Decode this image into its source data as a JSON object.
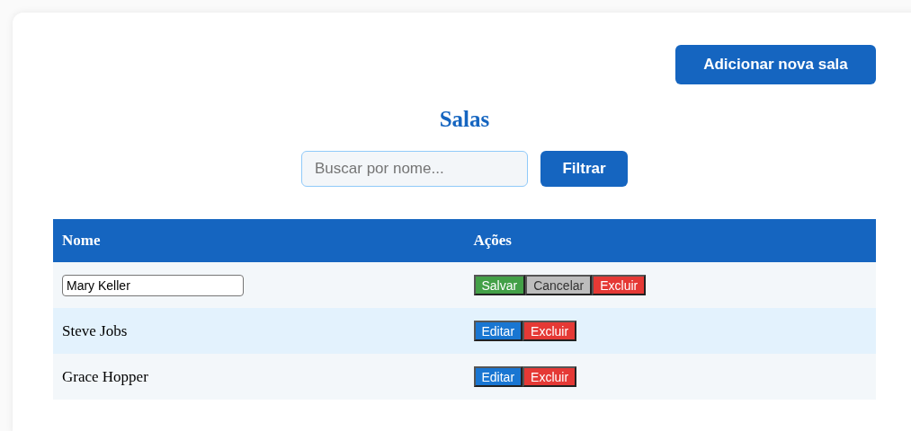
{
  "add_button": "Adicionar nova sala",
  "title": "Salas",
  "search": {
    "placeholder": "Buscar por nome..."
  },
  "filter_button": "Filtrar",
  "table": {
    "columns": [
      "Nome",
      "Ações"
    ],
    "rows": [
      {
        "name": "Mary Keller",
        "editing": true,
        "actions": [
          {
            "kind": "save",
            "label": "Salvar"
          },
          {
            "kind": "cancel",
            "label": "Cancelar"
          },
          {
            "kind": "delete",
            "label": "Excluir"
          }
        ]
      },
      {
        "name": "Steve Jobs",
        "editing": false,
        "actions": [
          {
            "kind": "edit",
            "label": "Editar"
          },
          {
            "kind": "delete",
            "label": "Excluir"
          }
        ]
      },
      {
        "name": "Grace Hopper",
        "editing": false,
        "actions": [
          {
            "kind": "edit",
            "label": "Editar"
          },
          {
            "kind": "delete",
            "label": "Excluir"
          }
        ]
      }
    ]
  }
}
